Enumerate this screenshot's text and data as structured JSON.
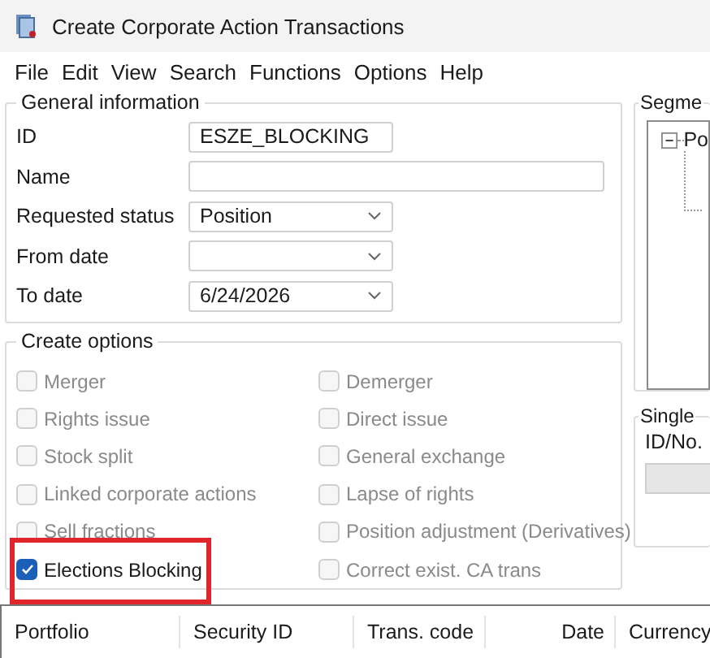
{
  "window": {
    "title": "Create Corporate Action Transactions"
  },
  "menu": [
    "File",
    "Edit",
    "View",
    "Search",
    "Functions",
    "Options",
    "Help"
  ],
  "general_information": {
    "title": "General information",
    "fields": [
      {
        "label": "ID",
        "kind": "text",
        "value": "ESZE_BLOCKING"
      },
      {
        "label": "Name",
        "kind": "wide_text"
      },
      {
        "label": "Requested status",
        "kind": "dropdown",
        "value": "Position"
      },
      {
        "label": "From date",
        "kind": "dropdown"
      },
      {
        "label": "To date",
        "kind": "dropdown",
        "value": "6/24/2026"
      }
    ]
  },
  "create_options": {
    "title": "Create options",
    "options": [
      {
        "label": "Merger",
        "checked": false,
        "disabled": true
      },
      {
        "label": "Demerger",
        "checked": false,
        "disabled": true
      },
      {
        "label": "Rights issue",
        "checked": false,
        "disabled": true
      },
      {
        "label": "Direct issue",
        "checked": false,
        "disabled": true
      },
      {
        "label": "Stock split",
        "checked": false,
        "disabled": true
      },
      {
        "label": "General exchange",
        "checked": false,
        "disabled": true
      },
      {
        "label": "Linked corporate actions",
        "checked": false,
        "disabled": true
      },
      {
        "label": "Lapse of rights",
        "checked": false,
        "disabled": true
      },
      {
        "label": "Sell fractions",
        "checked": false,
        "disabled": true
      },
      {
        "label": "Position adjustment (Derivatives)",
        "checked": false,
        "disabled": true
      },
      {
        "label": "Elections Blocking",
        "checked": true,
        "disabled": false,
        "highlighted": true
      },
      {
        "label": "Correct exist. CA trans",
        "checked": false,
        "disabled": true
      }
    ]
  },
  "segment": {
    "title": "Segme",
    "tree": [
      {
        "label": "Po",
        "expanded": true
      }
    ]
  },
  "single_selection": {
    "title": "Single",
    "label": "ID/No."
  },
  "table": {
    "columns": [
      "Portfolio",
      "Security ID",
      "Trans. code",
      "Date",
      "Currency"
    ]
  }
}
